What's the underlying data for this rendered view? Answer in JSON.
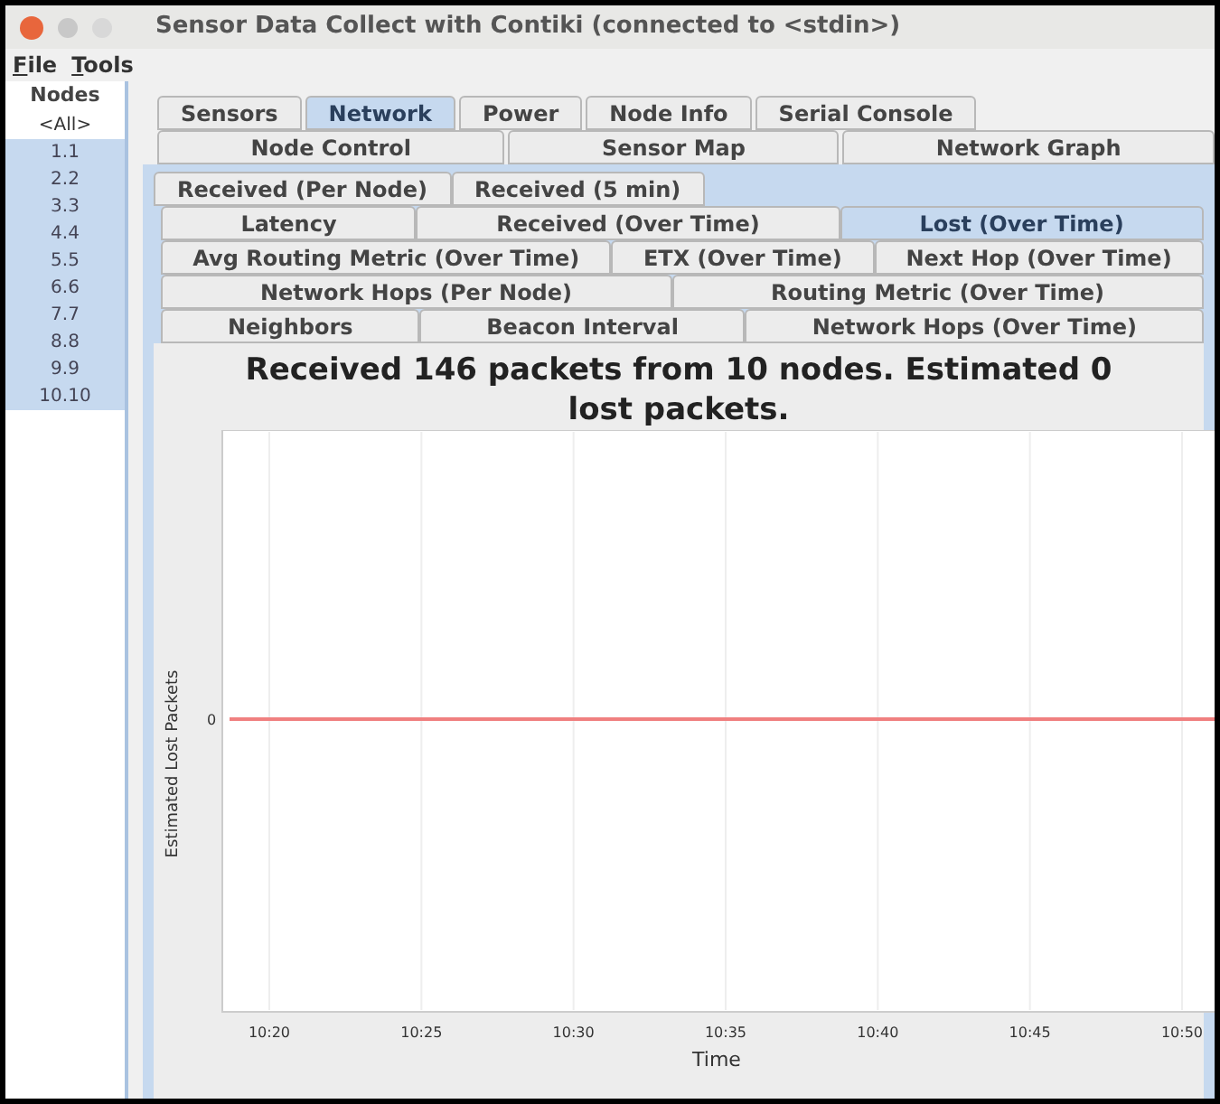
{
  "window": {
    "title": "Sensor Data Collect with Contiki (connected to <stdin>)"
  },
  "menu": [
    {
      "label": "File"
    },
    {
      "label": "Tools"
    }
  ],
  "nodes": {
    "header": "Nodes",
    "items": [
      {
        "label": "<All>",
        "selected": false
      },
      {
        "label": "1.1",
        "selected": true
      },
      {
        "label": "2.2",
        "selected": true
      },
      {
        "label": "3.3",
        "selected": true
      },
      {
        "label": "4.4",
        "selected": true
      },
      {
        "label": "5.5",
        "selected": true
      },
      {
        "label": "6.6",
        "selected": true
      },
      {
        "label": "7.7",
        "selected": true
      },
      {
        "label": "8.8",
        "selected": true
      },
      {
        "label": "9.9",
        "selected": true
      },
      {
        "label": "10.10",
        "selected": true
      }
    ]
  },
  "tab_rows": [
    [
      {
        "label": "Sensors",
        "selected": false
      },
      {
        "label": "Network",
        "selected": true
      },
      {
        "label": "Power",
        "selected": false
      },
      {
        "label": "Node Info",
        "selected": false
      },
      {
        "label": "Serial Console",
        "selected": false
      }
    ],
    [
      {
        "label": "Node Control",
        "selected": false
      },
      {
        "label": "Sensor Map",
        "selected": false
      },
      {
        "label": "Network Graph",
        "selected": false
      }
    ]
  ],
  "subtab_rows": [
    [
      {
        "label": "Received (Per Node)",
        "selected": false
      },
      {
        "label": "Received (5 min)",
        "selected": false
      }
    ],
    [
      {
        "label": "Latency",
        "selected": false
      },
      {
        "label": "Received (Over Time)",
        "selected": false
      },
      {
        "label": "Lost (Over Time)",
        "selected": true
      }
    ],
    [
      {
        "label": "Avg Routing Metric (Over Time)",
        "selected": false
      },
      {
        "label": "ETX (Over Time)",
        "selected": false
      },
      {
        "label": "Next Hop (Over Time)",
        "selected": false
      }
    ],
    [
      {
        "label": "Network Hops (Per Node)",
        "selected": false
      },
      {
        "label": "Routing Metric (Over Time)",
        "selected": false
      }
    ],
    [
      {
        "label": "Neighbors",
        "selected": false
      },
      {
        "label": "Beacon Interval",
        "selected": false
      },
      {
        "label": "Network Hops (Over Time)",
        "selected": false
      }
    ]
  ],
  "chart": {
    "title": "Received 146 packets from 10 nodes. Estimated 0 lost packets.",
    "xlabel": "Time",
    "ylabel": "Estimated Lost Packets",
    "x_ticks": [
      "10:20",
      "10:25",
      "10:30",
      "10:35",
      "10:40",
      "10:45",
      "10:50"
    ],
    "y_tick": "0"
  }
}
